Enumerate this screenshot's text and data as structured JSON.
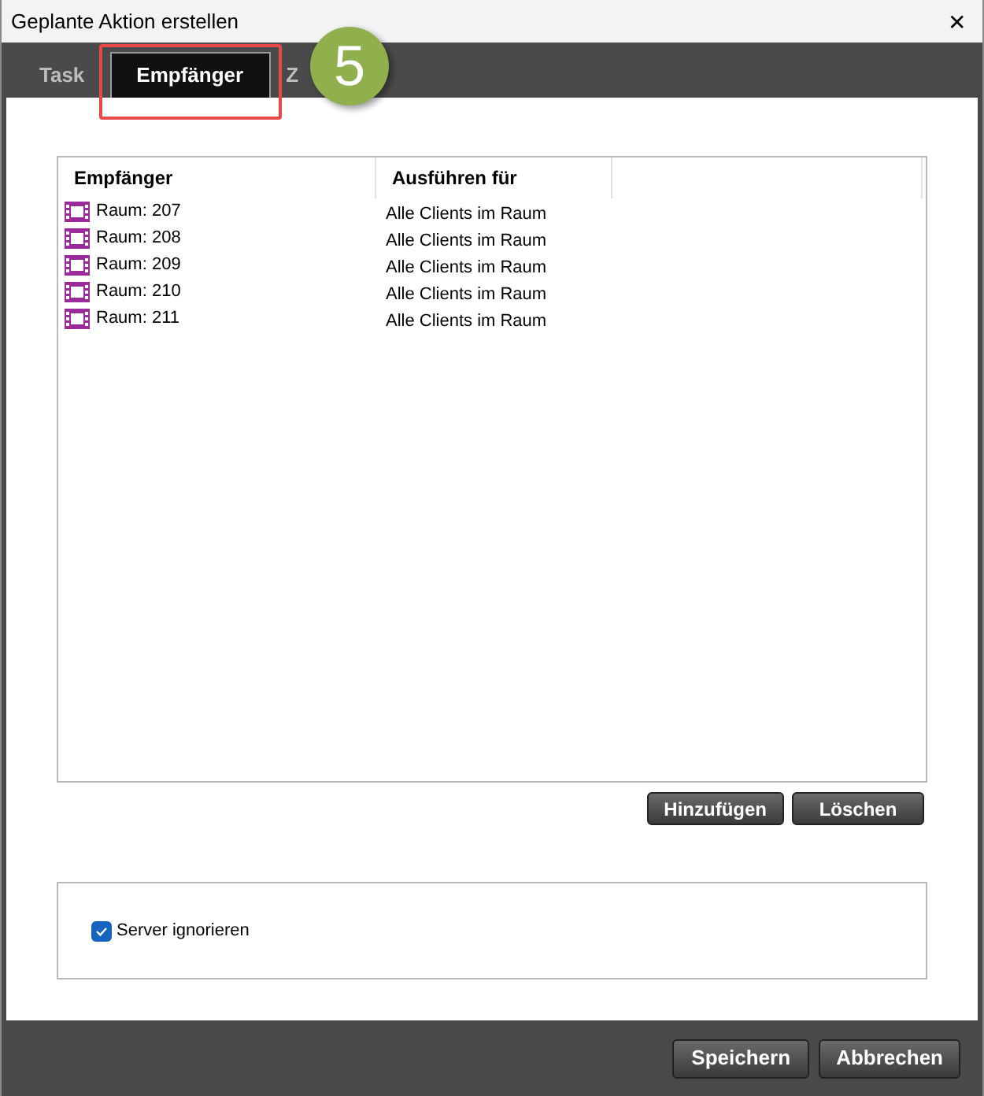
{
  "window": {
    "title": "Geplante Aktion erstellen",
    "close": "✕"
  },
  "tabs": [
    {
      "label": "Task",
      "selected": false
    },
    {
      "label": "Empfänger",
      "selected": true
    },
    {
      "label": "Z",
      "selected": false
    }
  ],
  "step_badge": "5",
  "table": {
    "columns": [
      "Empfänger",
      "Ausführen für"
    ],
    "rows": [
      {
        "recipient": "Raum: 207",
        "run_for": "Alle Clients im Raum"
      },
      {
        "recipient": "Raum: 208",
        "run_for": "Alle Clients im Raum"
      },
      {
        "recipient": "Raum: 209",
        "run_for": "Alle Clients im Raum"
      },
      {
        "recipient": "Raum: 210",
        "run_for": "Alle Clients im Raum"
      },
      {
        "recipient": "Raum: 211",
        "run_for": "Alle Clients im Raum"
      }
    ]
  },
  "table_buttons": [
    "Hinzufügen",
    "Löschen"
  ],
  "options": [
    {
      "label": "Server ignorieren",
      "checked": true
    }
  ],
  "buttons": [
    "Speichern",
    "Abbrechen"
  ]
}
